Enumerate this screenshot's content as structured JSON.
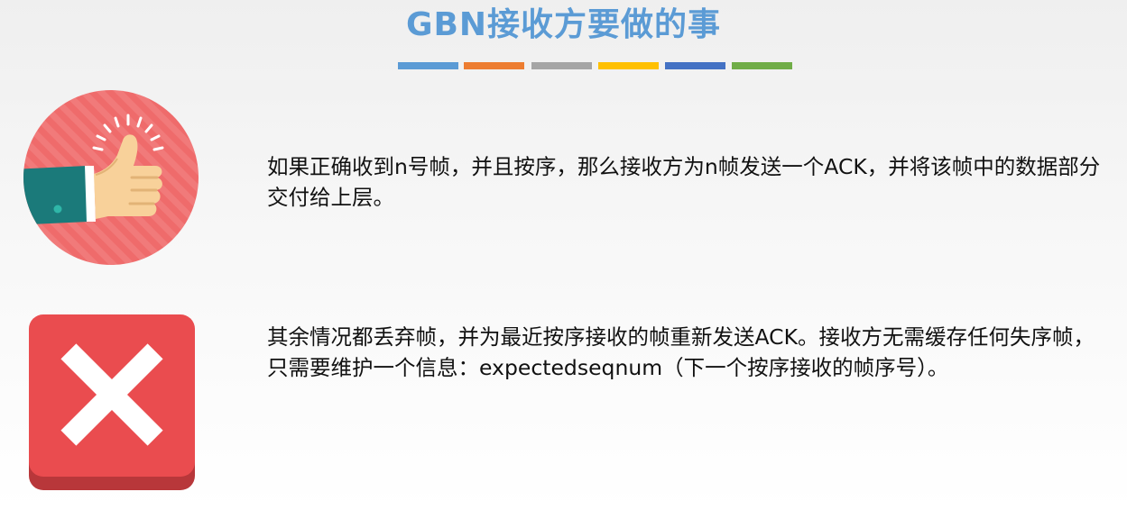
{
  "slide": {
    "title": "GBN接收方要做的事",
    "title_color": "#5b9bd5",
    "bar_colors": [
      "#5b9bd5",
      "#ed7d31",
      "#a5a5a5",
      "#ffc000",
      "#4472c4",
      "#70ad47"
    ]
  },
  "items": [
    {
      "icon": "thumbs-up-icon",
      "text": "如果正确收到n号帧，并且按序，那么接收方为n帧发送一个ACK，并将该帧中的数据部分交付给上层。"
    },
    {
      "icon": "red-x-icon",
      "text": "其余情况都丢弃帧，并为最近按序接收的帧重新发送ACK。接收方无需缓存任何失序帧，只需要维护一个信息：expectedseqnum（下一个按序接收的帧序号）。"
    }
  ]
}
